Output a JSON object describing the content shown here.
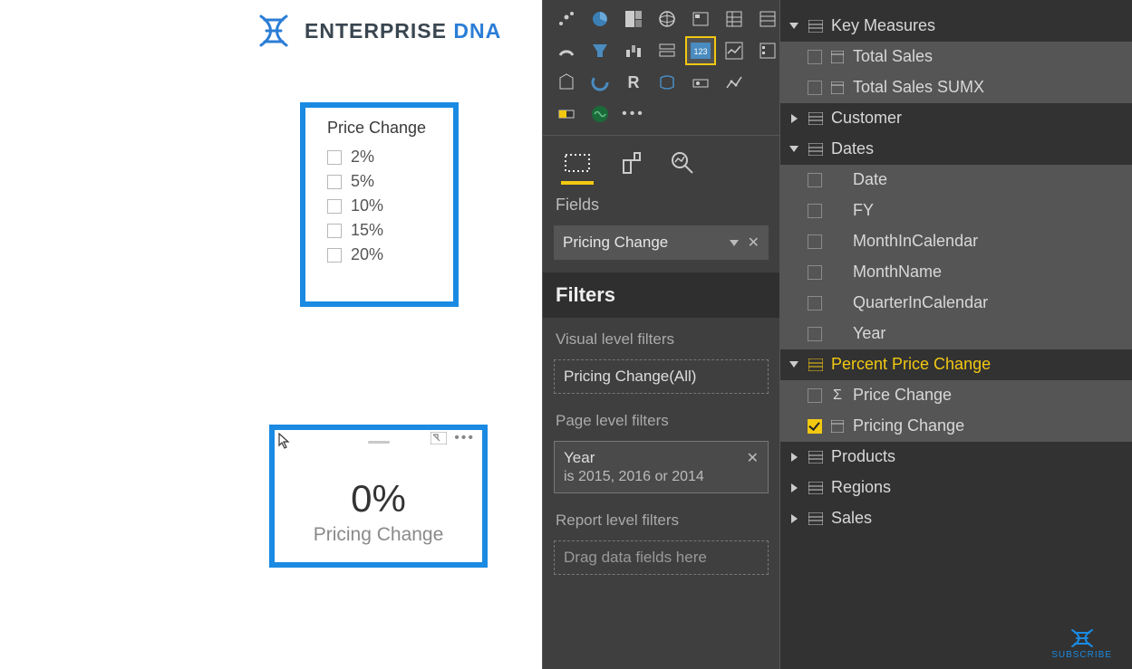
{
  "logo": {
    "brand": "ENTERPRISE ",
    "accent": "DNA"
  },
  "slicer": {
    "title": "Price Change",
    "options": [
      "2%",
      "5%",
      "10%",
      "15%",
      "20%"
    ]
  },
  "card": {
    "value": "0%",
    "label": "Pricing Change"
  },
  "viz_panel": {
    "field_label": "Fields",
    "field_value": "Pricing Change",
    "filters_header": "Filters",
    "visual_filters_label": "Visual level filters",
    "visual_filter_value": "Pricing Change(All)",
    "page_filters_label": "Page level filters",
    "page_filter_field": "Year",
    "page_filter_desc": "is 2015, 2016 or 2014",
    "report_filters_label": "Report level filters",
    "report_filter_placeholder": "Drag data fields here"
  },
  "fields": {
    "key_measures": {
      "label": "Key Measures",
      "items": [
        "Total Sales",
        "Total Sales SUMX"
      ]
    },
    "customer": "Customer",
    "dates": {
      "label": "Dates",
      "items": [
        "Date",
        "FY",
        "MonthInCalendar",
        "MonthName",
        "QuarterInCalendar",
        "Year"
      ]
    },
    "percent": {
      "label": "Percent Price Change",
      "price_change": "Price Change",
      "pricing_change": "Pricing Change"
    },
    "products": "Products",
    "regions": "Regions",
    "sales": "Sales"
  },
  "subscribe": "SUBSCRIBE"
}
